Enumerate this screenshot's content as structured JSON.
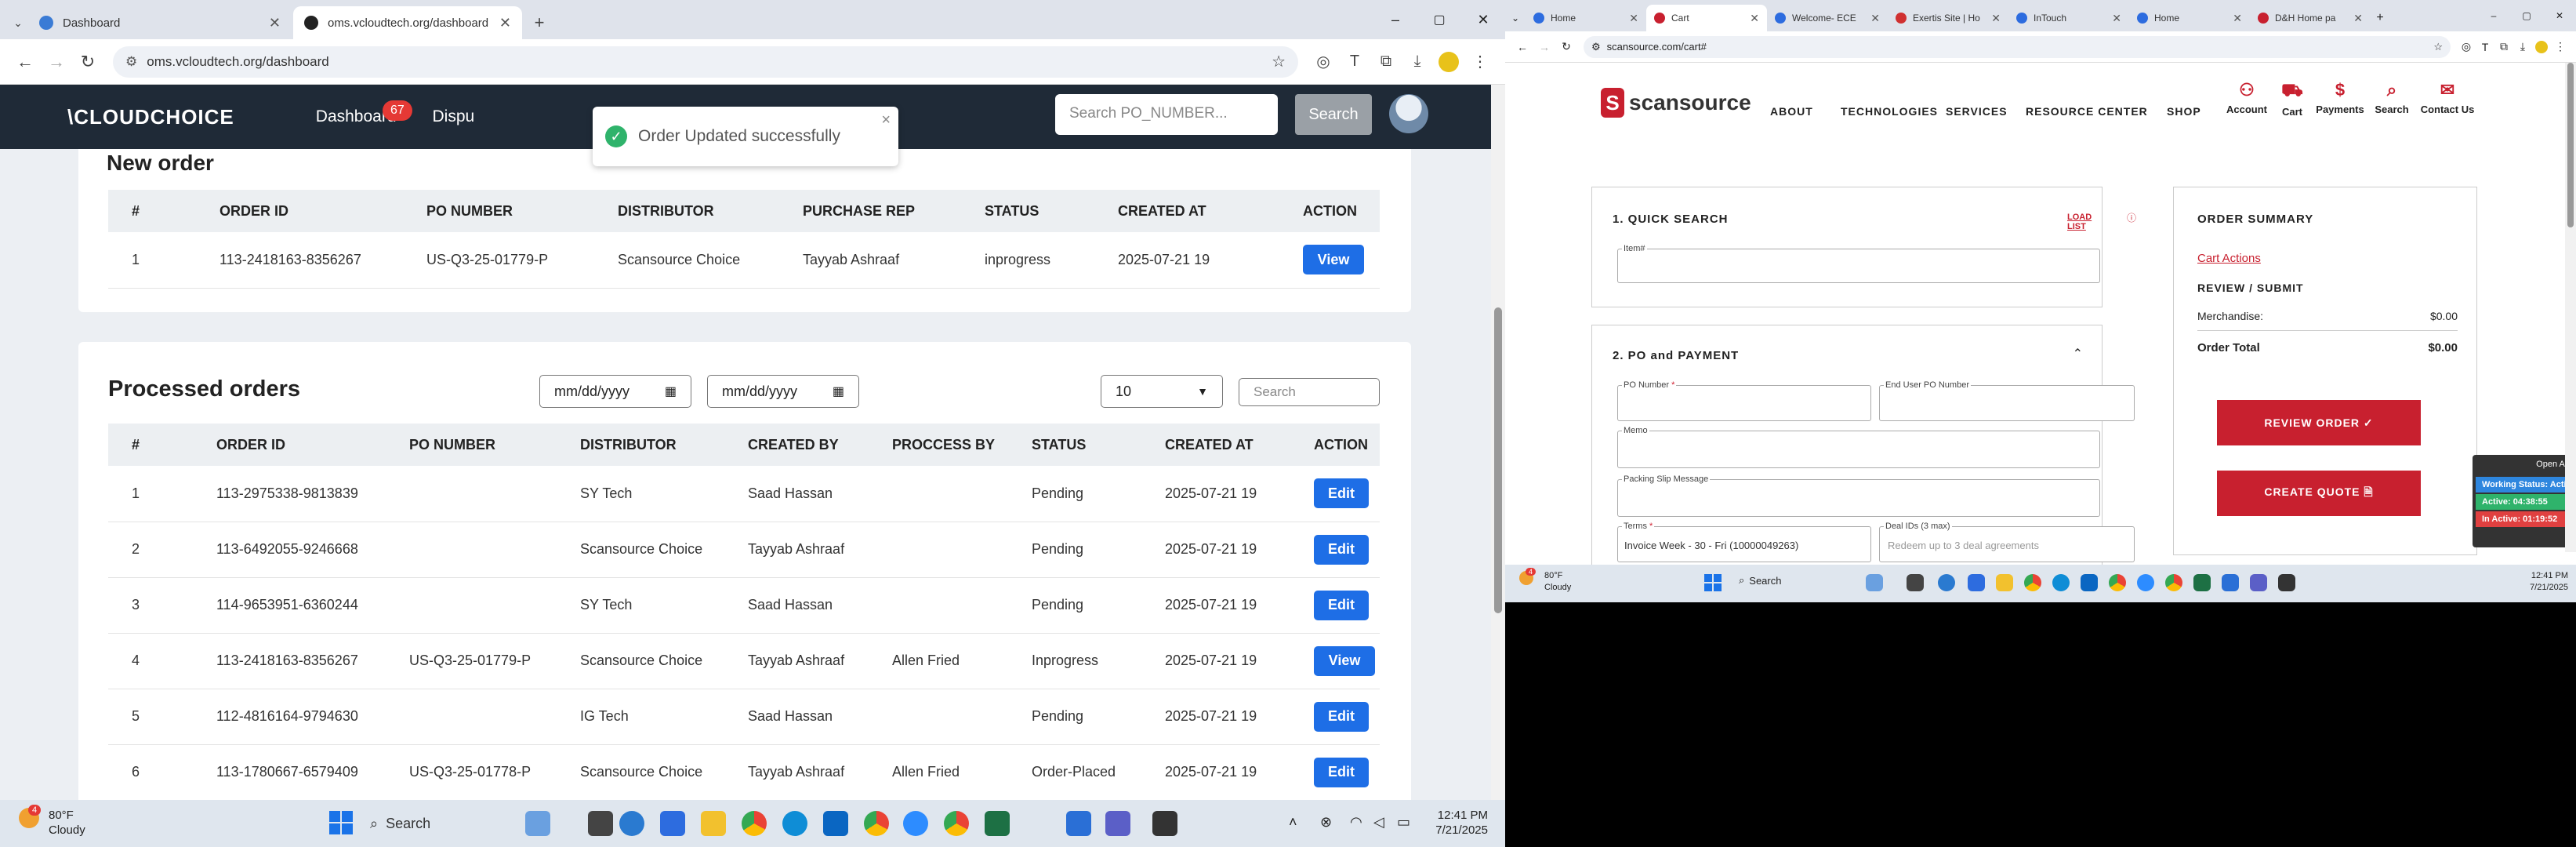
{
  "left_browser": {
    "tabs": [
      {
        "title": "Dashboard",
        "favicon_color": "#3a7bd5"
      },
      {
        "title": "oms.vcloudtech.org/dashboard",
        "favicon_color": "#222222"
      }
    ],
    "new_tab_glyph": "+",
    "url": "oms.vcloudtech.org/dashboard",
    "window_controls": [
      "–",
      "▢",
      "✕"
    ]
  },
  "app": {
    "logo": "\\CLOUDCHOICE",
    "nav": [
      {
        "label": "Dashboard"
      },
      {
        "label": "Dispu"
      }
    ],
    "dispute_count": "67",
    "search_placeholder": "Search PO_NUMBER...",
    "search_button": "Search",
    "toast": {
      "message": "Order Updated successfully",
      "close": "×"
    },
    "new_order": {
      "title": "New order",
      "headers": [
        "#",
        "ORDER ID",
        "PO NUMBER",
        "DISTRIBUTOR",
        "PURCHASE REP",
        "STATUS",
        "CREATED AT",
        "ACTION"
      ],
      "rows": [
        {
          "n": "1",
          "order_id": "113-2418163-8356267",
          "po": "US-Q3-25-01779-P",
          "distributor": "Scansource Choice",
          "rep": "Tayyab Ashraaf",
          "status": "inprogress",
          "created": "2025-07-21 19",
          "action": "View"
        }
      ]
    },
    "processed": {
      "title": "Processed orders",
      "date_from": "mm/dd/yyyy",
      "date_to": "mm/dd/yyyy",
      "page_size": "10",
      "search_placeholder": "Search",
      "headers": [
        "#",
        "ORDER ID",
        "PO NUMBER",
        "DISTRIBUTOR",
        "CREATED BY",
        "PROCCESS BY",
        "STATUS",
        "CREATED AT",
        "ACTION"
      ],
      "rows": [
        {
          "n": "1",
          "order_id": "113-2975338-9813839",
          "po": "",
          "distributor": "SY Tech",
          "created_by": "Saad Hassan",
          "process_by": "",
          "status": "Pending",
          "created": "2025-07-21 19",
          "action": "Edit"
        },
        {
          "n": "2",
          "order_id": "113-6492055-9246668",
          "po": "",
          "distributor": "Scansource Choice",
          "created_by": "Tayyab Ashraaf",
          "process_by": "",
          "status": "Pending",
          "created": "2025-07-21 19",
          "action": "Edit"
        },
        {
          "n": "3",
          "order_id": "114-9653951-6360244",
          "po": "",
          "distributor": "SY Tech",
          "created_by": "Saad Hassan",
          "process_by": "",
          "status": "Pending",
          "created": "2025-07-21 19",
          "action": "Edit"
        },
        {
          "n": "4",
          "order_id": "113-2418163-8356267",
          "po": "US-Q3-25-01779-P",
          "distributor": "Scansource Choice",
          "created_by": "Tayyab Ashraaf",
          "process_by": "Allen Fried",
          "status": "Inprogress",
          "created": "2025-07-21 19",
          "action": "View"
        },
        {
          "n": "5",
          "order_id": "112-4816164-9794630",
          "po": "",
          "distributor": "IG Tech",
          "created_by": "Saad Hassan",
          "process_by": "",
          "status": "Pending",
          "created": "2025-07-21 19",
          "action": "Edit"
        },
        {
          "n": "6",
          "order_id": "113-1780667-6579409",
          "po": "US-Q3-25-01778-P",
          "distributor": "Scansource Choice",
          "created_by": "Tayyab Ashraaf",
          "process_by": "Allen Fried",
          "status": "Order-Placed",
          "created": "2025-07-21 19",
          "action": "Edit"
        }
      ]
    }
  },
  "taskbar_left": {
    "weather_temp": "80°F",
    "weather_desc": "Cloudy",
    "weather_badge": "4",
    "search": "Search",
    "time": "12:41 PM",
    "date": "7/21/2025"
  },
  "right_browser": {
    "tabs": [
      {
        "title": "Home",
        "favicon_color": "#2d6cdf"
      },
      {
        "title": "Cart",
        "favicon_color": "#c8202f"
      },
      {
        "title": "Welcome- ECE",
        "favicon_color": "#2d6cdf"
      },
      {
        "title": "Exertis Site | Ho",
        "favicon_color": "#d03030"
      },
      {
        "title": "InTouch",
        "favicon_color": "#2d6cdf"
      },
      {
        "title": "Home",
        "favicon_color": "#2d6cdf"
      },
      {
        "title": "D&H Home pa",
        "favicon_color": "#c8202f"
      }
    ],
    "url": "scansource.com/cart#",
    "site": {
      "logo": "scansource",
      "menu": [
        "ABOUT",
        "TECHNOLOGIES",
        "SERVICES",
        "RESOURCE CENTER",
        "SHOP"
      ],
      "icons": [
        {
          "label": "Account",
          "icon": "person-icon",
          "glyph": "⚇"
        },
        {
          "label": "Cart",
          "icon": "cart-icon",
          "glyph": "⛟"
        },
        {
          "label": "Payments",
          "icon": "dollar-icon",
          "glyph": "$"
        },
        {
          "label": "Search",
          "icon": "search-icon",
          "glyph": "⌕"
        },
        {
          "label": "Contact Us",
          "icon": "chat-icon",
          "glyph": "✉"
        }
      ],
      "quick_search": {
        "title": "1. QUICK SEARCH",
        "load_list": "LOAD LIST",
        "item_label": "Item#"
      },
      "po_payment": {
        "title": "2. PO and PAYMENT",
        "po_number": "PO Number",
        "end_user_po": "End User PO Number",
        "memo": "Memo",
        "packing_slip": "Packing Slip Message",
        "terms": "Terms",
        "terms_value": "Invoice Week - 30 - Fri (10000049263)",
        "deal_ids": "Deal IDs (3 max)",
        "deal_placeholder": "Redeem up to 3 deal agreements"
      },
      "summary": {
        "title": "ORDER SUMMARY",
        "cart_actions": "Cart Actions",
        "review_title": "REVIEW / SUBMIT",
        "merch_label": "Merchandise:",
        "merch_value": "$0.00",
        "total_label": "Order Total",
        "total_value": "$0.00",
        "review_btn": "REVIEW ORDER ✓",
        "quote_btn": "CREATE QUOTE 🗎"
      },
      "side_widget": {
        "title": "Open Ap",
        "working": "Working Status: Activ",
        "active": "Active: 04:38:55",
        "inactive": "In Active: 01:19:52"
      }
    }
  },
  "taskbar_right": {
    "weather_temp": "80°F",
    "weather_desc": "Cloudy",
    "weather_badge": "4",
    "search": "Search",
    "time": "12:41 PM",
    "date": "7/21/2025"
  },
  "colors": {
    "navbar": "#1f2a37",
    "button_blue": "#1e6ee6",
    "scansource_red": "#c8202f",
    "toast_green": "#2fb36b"
  }
}
